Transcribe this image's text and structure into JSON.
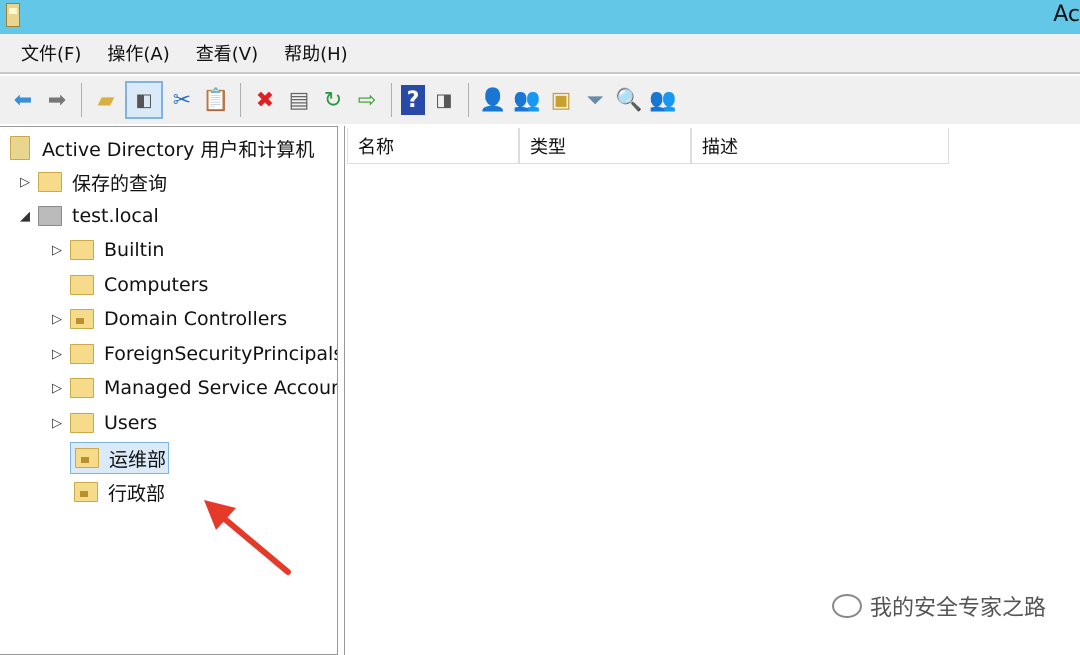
{
  "window": {
    "title": "Ac"
  },
  "menu": [
    "文件(F)",
    "操作(A)",
    "查看(V)",
    "帮助(H)"
  ],
  "tree": {
    "root": "Active Directory 用户和计算机",
    "saved": "保存的查询",
    "domain": "test.local",
    "children": [
      "Builtin",
      "Computers",
      "Domain Controllers",
      "ForeignSecurityPrincipals",
      "Managed Service Accounts",
      "Users",
      "运维部",
      "行政部"
    ]
  },
  "columns": [
    "名称",
    "类型",
    "描述"
  ],
  "watermark": "我的安全专家之路"
}
